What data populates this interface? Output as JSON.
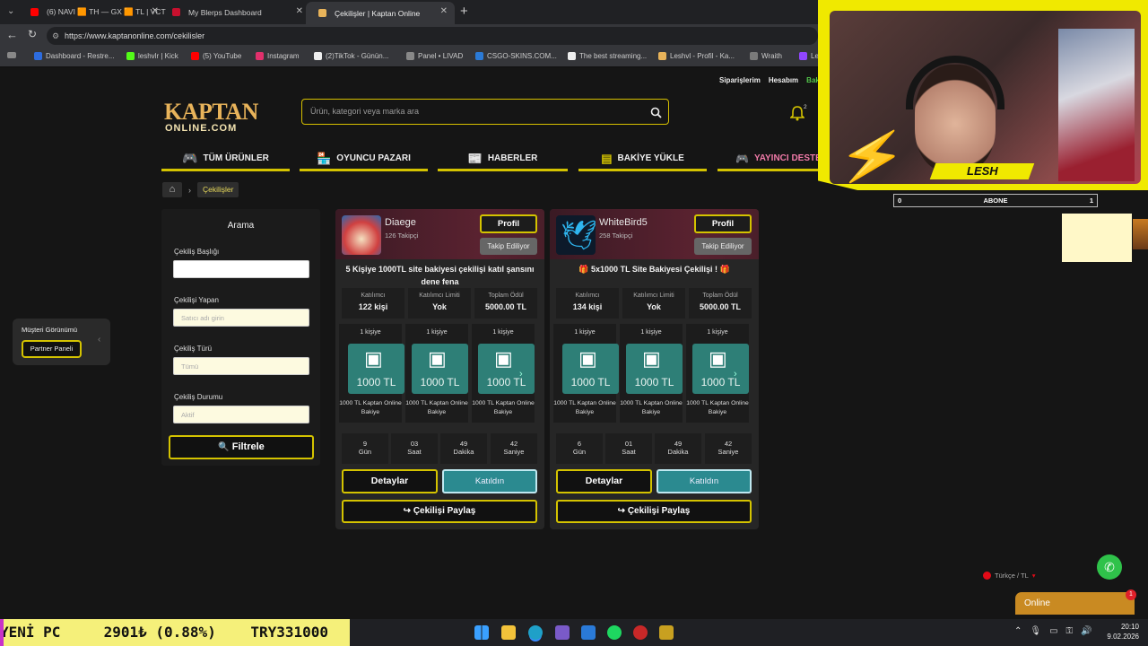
{
  "browser": {
    "tabs": [
      {
        "title": "(6) NAVI 🟧 TH — GX 🟧 TL | VCT",
        "favicon_color": "#ff0000"
      },
      {
        "title": "My Blerps Dashboard",
        "favicon_color": "#c8102e"
      },
      {
        "title": "Çekilişler | Kaptan Online",
        "favicon_color": "#e8b35a"
      }
    ],
    "url": "https://www.kaptanonline.com/cekilisler",
    "bookmarks": [
      {
        "label": "Dashboard - Restre...",
        "color": "#2d6cdf"
      },
      {
        "label": "leshvlr | Kick",
        "color": "#53fc18"
      },
      {
        "label": "(5) YouTube",
        "color": "#ff0000"
      },
      {
        "label": "Instagram",
        "color": "#e1306c"
      },
      {
        "label": "(2)TikTok - Günün...",
        "color": "#ffffff"
      },
      {
        "label": "Panel • LIVAD",
        "color": "#888888"
      },
      {
        "label": "CSGO-SKINS.COM...",
        "color": "#2b7ad6"
      },
      {
        "label": "The best streaming...",
        "color": "#ffffff"
      },
      {
        "label": "Leshvl - Profil - Ka...",
        "color": "#e8b35a"
      },
      {
        "label": "Wraith",
        "color": "#7a7a7a"
      },
      {
        "label": "Le",
        "color": "#9146ff"
      }
    ]
  },
  "site": {
    "logo_line1": "KAPTAN",
    "logo_line2": "ONLINE.COM",
    "top_links": [
      "Siparişlerim",
      "Hesabım",
      "Bak"
    ],
    "search_placeholder": "Ürün, kategori veya marka ara",
    "notification_count": "2",
    "nav": [
      "TÜM ÜRÜNLER",
      "OYUNCU PAZARI",
      "HABERLER",
      "BAKİYE YÜKLE",
      "YAYINCI DESTE"
    ],
    "breadcrumb": "Çekilişler",
    "side_widget": {
      "label": "Müşteri Görünümü",
      "button": "Partner Paneli"
    },
    "filter": {
      "title": "Arama",
      "fields": [
        {
          "label": "Çekiliş Başlığı",
          "placeholder": ""
        },
        {
          "label": "Çekilişi Yapan",
          "placeholder": "Satıcı adı girin"
        },
        {
          "label": "Çekiliş Türü",
          "placeholder": "Tümü"
        },
        {
          "label": "Çekiliş Durumu",
          "placeholder": "Aktif"
        }
      ],
      "button": "Filtrele"
    },
    "giveaways": [
      {
        "user": "Diaege",
        "followers": "126 Takipçi",
        "profile_btn": "Profil",
        "follow_btn": "Takip Ediliyor",
        "title": "5 Kişiye 1000TL site bakiyesi çekilişi katıl şansını dene fena",
        "stats": [
          {
            "label": "Katılımcı",
            "value": "122 kişi"
          },
          {
            "label": "Katılımcı Limiti",
            "value": "Yok"
          },
          {
            "label": "Toplam Ödül",
            "value": "5000.00 TL"
          }
        ],
        "prizes": [
          {
            "per": "1 kişiye",
            "amount": "1000 TL",
            "desc": "1000 TL Kaptan Online Bakiye"
          },
          {
            "per": "1 kişiye",
            "amount": "1000 TL",
            "desc": "1000 TL Kaptan Online Bakiye"
          },
          {
            "per": "1 kişiye",
            "amount": "1000 TL",
            "desc": "1000 TL Kaptan Online Bakiye"
          }
        ],
        "countdown": [
          {
            "n": "9",
            "u": "Gün"
          },
          {
            "n": "03",
            "u": "Saat"
          },
          {
            "n": "49",
            "u": "Dakika"
          },
          {
            "n": "42",
            "u": "Saniye"
          }
        ],
        "details_btn": "Detaylar",
        "joined_btn": "Katıldın",
        "share_btn": "Çekilişi Paylaş"
      },
      {
        "user": "WhiteBird5",
        "followers": "258 Takipçi",
        "profile_btn": "Profil",
        "follow_btn": "Takip Ediliyor",
        "title": "🎁 5x1000 TL Site Bakiyesi Çekilişi ! 🎁",
        "stats": [
          {
            "label": "Katılımcı",
            "value": "134 kişi"
          },
          {
            "label": "Katılımcı Limiti",
            "value": "Yok"
          },
          {
            "label": "Toplam Ödül",
            "value": "5000.00 TL"
          }
        ],
        "prizes": [
          {
            "per": "1 kişiye",
            "amount": "1000 TL",
            "desc": "1000 TL Kaptan Online Bakiye"
          },
          {
            "per": "1 kişiye",
            "amount": "1000 TL",
            "desc": "1000 TL Kaptan Online Bakiye"
          },
          {
            "per": "1 kişiye",
            "amount": "1000 TL",
            "desc": "1000 TL Kaptan Online Bakiye"
          }
        ],
        "countdown": [
          {
            "n": "6",
            "u": "Gün"
          },
          {
            "n": "01",
            "u": "Saat"
          },
          {
            "n": "49",
            "u": "Dakika"
          },
          {
            "n": "42",
            "u": "Saniye"
          }
        ],
        "details_btn": "Detaylar",
        "joined_btn": "Katıldın",
        "share_btn": "Çekilişi Paylaş"
      }
    ],
    "language": "Türkçe / TL",
    "chat": {
      "label": "Online",
      "badge": "1"
    }
  },
  "stream_overlay": {
    "name": "LESH",
    "abone": {
      "left": "0",
      "label": "ABONE",
      "right": "1"
    }
  },
  "ticker": "YENİ PC     2901₺ (0.88%)    TRY331000",
  "taskbar": {
    "time": "20:10",
    "date": "9.02.2026"
  }
}
